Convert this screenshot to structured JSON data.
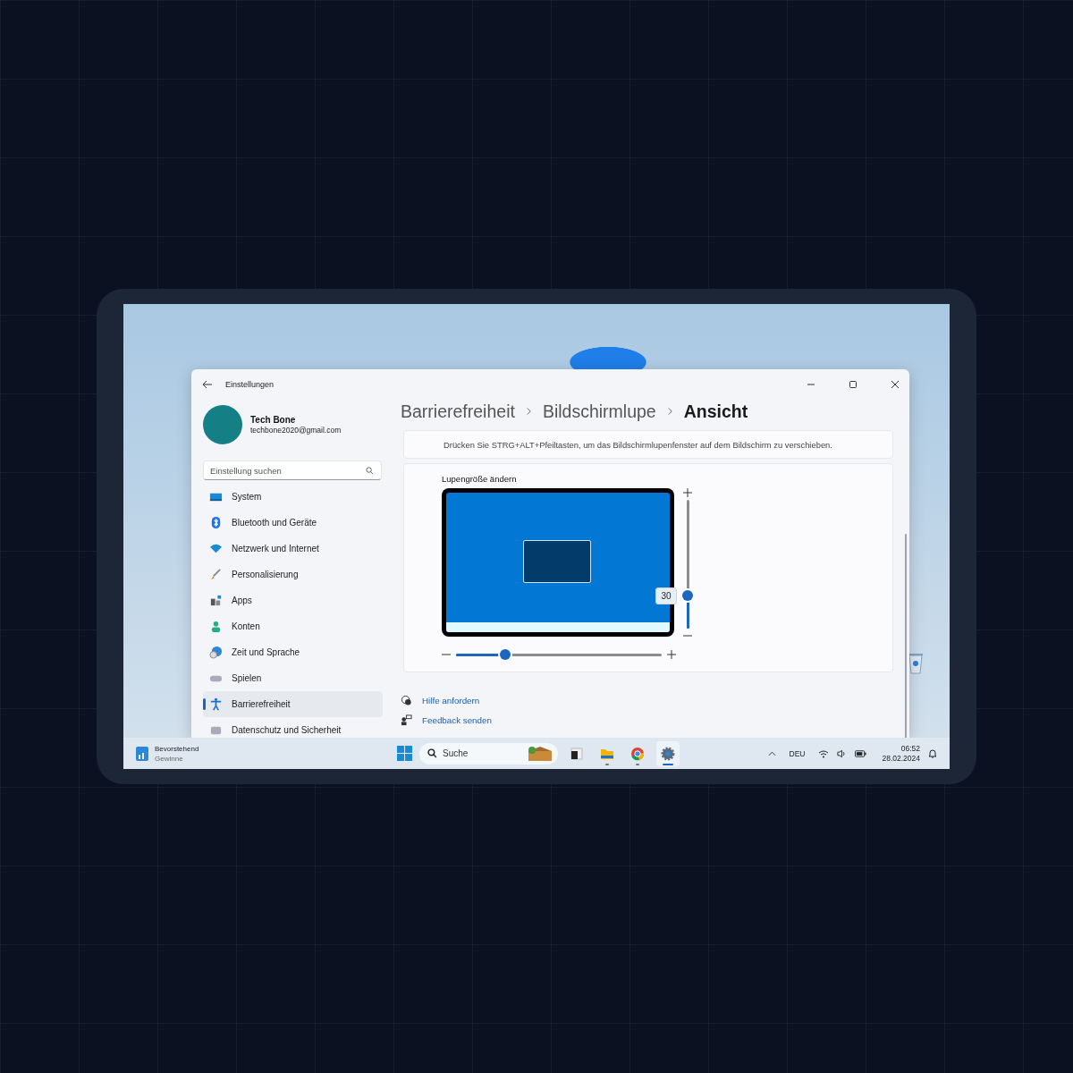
{
  "window": {
    "title": "Einstellungen"
  },
  "profile": {
    "name": "Tech Bone",
    "email": "techbone2020@gmail.com"
  },
  "search": {
    "placeholder": "Einstellung suchen"
  },
  "sidebar": {
    "items": [
      {
        "kind": "system",
        "label": "System",
        "selected": false
      },
      {
        "kind": "bluetooth",
        "label": "Bluetooth und Geräte",
        "selected": false
      },
      {
        "kind": "network",
        "label": "Netzwerk und Internet",
        "selected": false
      },
      {
        "kind": "personalization",
        "label": "Personalisierung",
        "selected": false
      },
      {
        "kind": "apps",
        "label": "Apps",
        "selected": false
      },
      {
        "kind": "accounts",
        "label": "Konten",
        "selected": false
      },
      {
        "kind": "time",
        "label": "Zeit und Sprache",
        "selected": false
      },
      {
        "kind": "gaming",
        "label": "Spielen",
        "selected": false
      },
      {
        "kind": "accessibility",
        "label": "Barrierefreiheit",
        "selected": true
      },
      {
        "kind": "privacy",
        "label": "Datenschutz und Sicherheit",
        "selected": false
      }
    ]
  },
  "breadcrumb": [
    "Barrierefreiheit",
    "Bildschirmlupe",
    "Ansicht"
  ],
  "hint": "Drücken Sie STRG+ALT+Pfeiltasten, um das Bildschirmlupenfenster auf dem Bildschirm zu verschieben.",
  "lens_size": {
    "title": "Lupengröße ändern",
    "height_slider": {
      "level": 0.26,
      "reading": "30"
    },
    "width_slider": {
      "level": 0.24
    }
  },
  "links": [
    {
      "kind": "help",
      "label": "Hilfe anfordern"
    },
    {
      "kind": "feedback",
      "label": "Feedback senden"
    }
  ],
  "taskbar": {
    "widget": {
      "title": "Bevorstehend",
      "subtitle": "Gewinne"
    },
    "search": {
      "placeholder": "Suche"
    },
    "apps": [
      {
        "kind": "terminal",
        "running": false,
        "selected": false
      },
      {
        "kind": "folder",
        "running": true,
        "selected": false
      },
      {
        "kind": "browser",
        "running": true,
        "selected": false
      },
      {
        "kind": "settings",
        "running": true,
        "selected": true
      }
    ],
    "language": "DEU",
    "time": "06:52",
    "date": "28.02.2024"
  }
}
